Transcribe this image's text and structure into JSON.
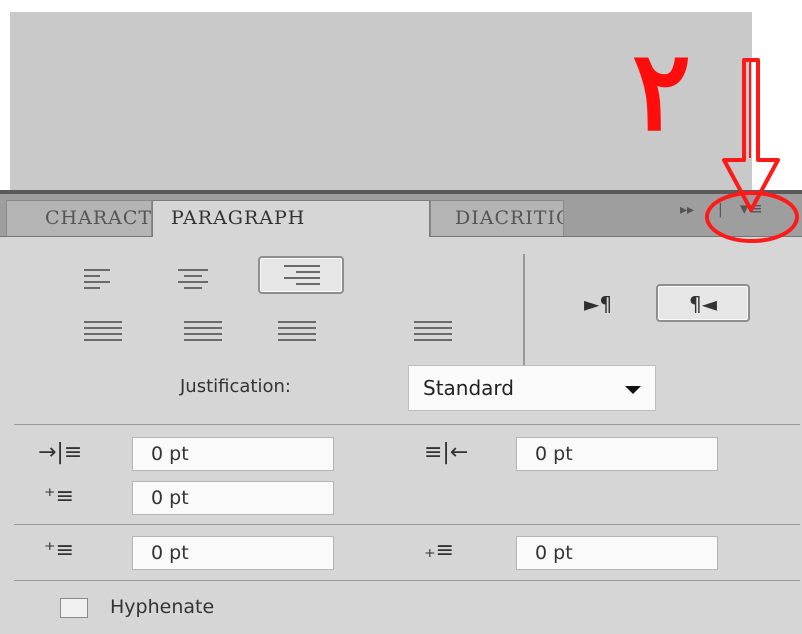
{
  "tabs": [
    {
      "label": "CHARACTER"
    },
    {
      "label": "PARAGRAPH",
      "active": true
    },
    {
      "label": "DIACRITICS"
    }
  ],
  "tab_controls": {
    "expand_glyph": "▸▸",
    "menu_glyph": "▾≡"
  },
  "direction_buttons": {
    "ltr": "►¶",
    "rtl": "¶◄"
  },
  "justification": {
    "label": "Justification:",
    "value": "Standard"
  },
  "indents": {
    "left": "0 pt",
    "right": "0 pt",
    "first_line": "0 pt",
    "space_before": "0 pt",
    "space_after": "0 pt"
  },
  "hyphenate_label": "Hyphenate",
  "annotation": {
    "number": "٢",
    "color": "#ff0d0d"
  }
}
